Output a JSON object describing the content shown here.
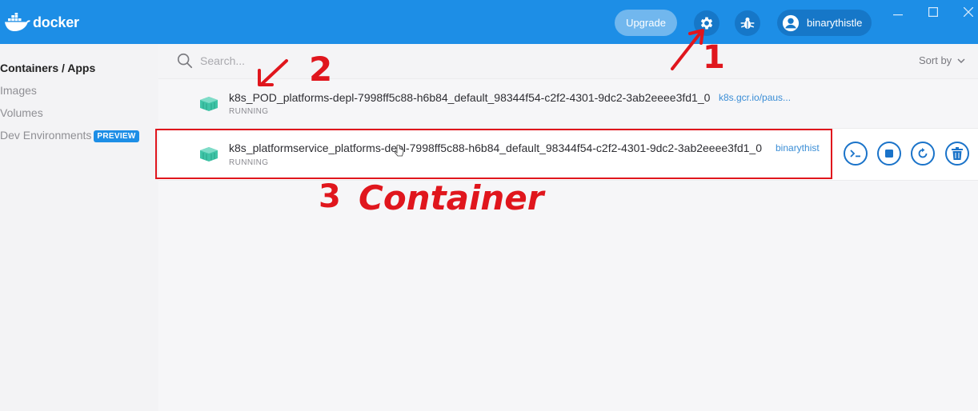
{
  "titlebar": {
    "app_name": "docker",
    "upgrade_label": "Upgrade",
    "username": "binarythistle",
    "icons": [
      "settings-gear-icon",
      "bug-icon",
      "user-avatar-icon"
    ],
    "window_controls": [
      "minimize",
      "maximize",
      "close"
    ],
    "colors": {
      "bar": "#1d8ee6",
      "upgrade": "#71b7ee",
      "pill": "#1677c8"
    }
  },
  "sidebar": {
    "items": [
      {
        "label": "Containers / Apps",
        "active": true
      },
      {
        "label": "Images",
        "active": false
      },
      {
        "label": "Volumes",
        "active": false
      },
      {
        "label": "Dev Environments",
        "active": false,
        "badge": "PREVIEW"
      }
    ]
  },
  "main": {
    "search_placeholder": "Search...",
    "sort_label": "Sort by",
    "containers": [
      {
        "name": "k8s_POD_platforms-depl-7998ff5c88-h6b84_default_98344f54-c2f2-4301-9dc2-3ab2eeee3fd1_0",
        "image": "k8s.gcr.io/paus...",
        "status": "RUNNING"
      },
      {
        "name": "k8s_platformservice_platforms-depl-7998ff5c88-h6b84_default_98344f54-c2f2-4301-9dc2-3ab2eeee3fd1_0",
        "image": "binarythist",
        "status": "RUNNING",
        "actions": [
          "cli-icon",
          "stop-icon",
          "restart-icon",
          "delete-icon"
        ]
      }
    ]
  },
  "annotations": {
    "mark_1": "1",
    "mark_2": "2",
    "mark_3": "3",
    "mark_3_word": "Container",
    "color": "#e0161d"
  }
}
